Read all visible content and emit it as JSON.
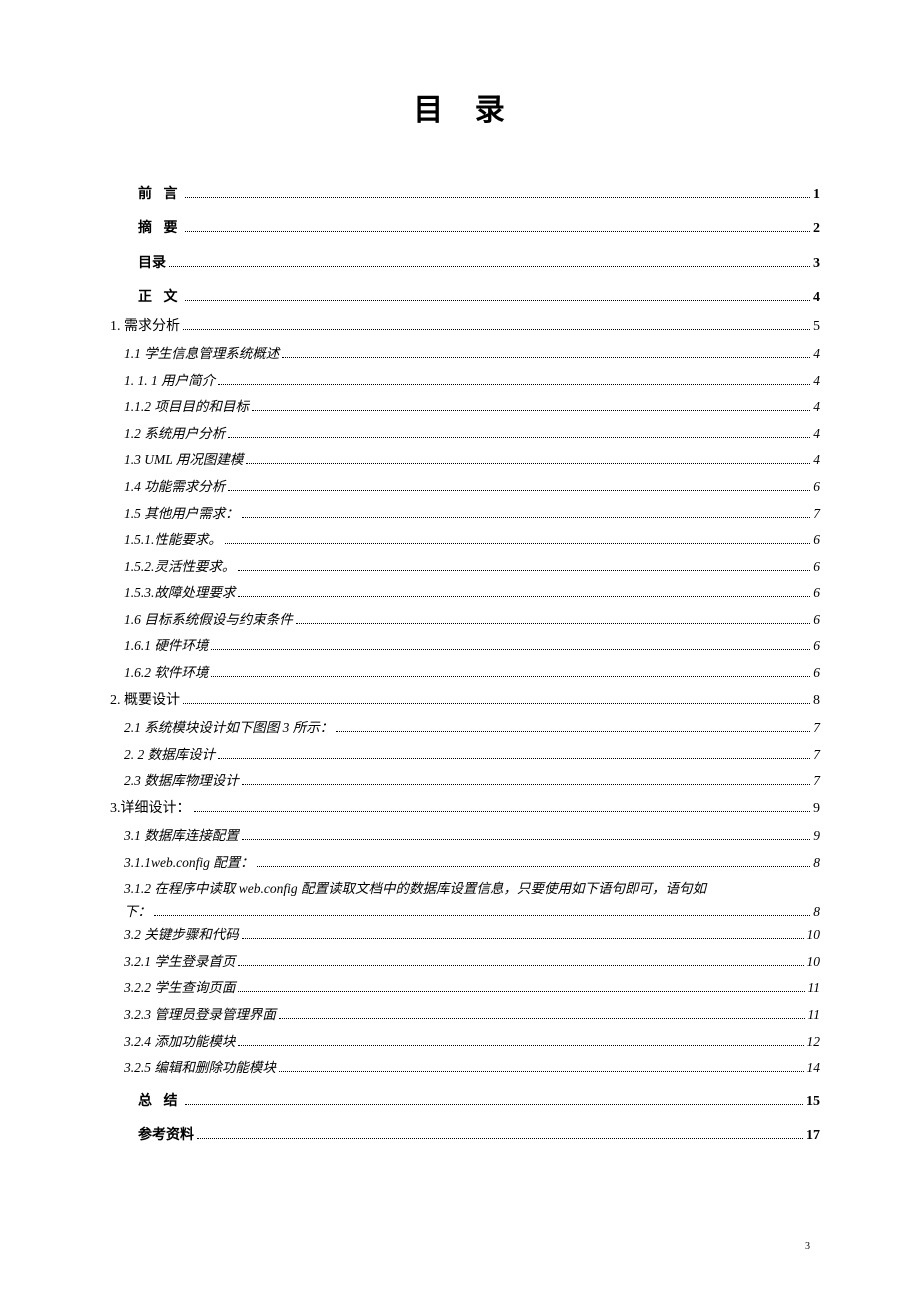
{
  "title": "目 录",
  "footer_page": "3",
  "entries": [
    {
      "type": "top",
      "label": "前 言",
      "page": "1",
      "spaced": true
    },
    {
      "type": "top",
      "label": "摘 要",
      "page": "2",
      "spaced": true
    },
    {
      "type": "top",
      "label": "目录",
      "page": "3"
    },
    {
      "type": "top",
      "label": "正 文",
      "page": "4",
      "spaced": true
    },
    {
      "type": "chapter",
      "label": "1. 需求分析",
      "page": "5"
    },
    {
      "type": "sub",
      "label": "1.1  学生信息管理系统概述",
      "page": "4"
    },
    {
      "type": "sub",
      "label": "1. 1. 1   用户简介",
      "page": "4"
    },
    {
      "type": "sub",
      "label": "1.1.2   项目目的和目标",
      "page": "4"
    },
    {
      "type": "sub",
      "label": "1.2  系统用户分析",
      "page": "4"
    },
    {
      "type": "sub",
      "label": "1.3 UML 用况图建模",
      "page": "4"
    },
    {
      "type": "sub",
      "label": "1.4  功能需求分析",
      "page": "6"
    },
    {
      "type": "sub",
      "label": "1.5  其他用户需求：",
      "page": "7"
    },
    {
      "type": "sub",
      "label": "1.5.1.性能要求。",
      "page": "6"
    },
    {
      "type": "sub",
      "label": "1.5.2.灵活性要求。",
      "page": "6"
    },
    {
      "type": "sub",
      "label": "1.5.3.故障处理要求",
      "page": "6"
    },
    {
      "type": "sub",
      "label": "1.6  目标系统假设与约束条件",
      "page": "6"
    },
    {
      "type": "sub",
      "label": "1.6.1   硬件环境",
      "page": "6"
    },
    {
      "type": "sub",
      "label": "1.6.2   软件环境",
      "page": "6"
    },
    {
      "type": "chapter",
      "label": "2. 概要设计",
      "page": "8"
    },
    {
      "type": "sub",
      "label": "2.1  系统模块设计如下图图 3 所示：",
      "page": "7"
    },
    {
      "type": "sub",
      "label": "2. 2  数据库设计",
      "page": "7"
    },
    {
      "type": "sub",
      "label": "2.3  数据库物理设计",
      "page": "7"
    },
    {
      "type": "chapter",
      "label": "3.详细设计：",
      "page": "9"
    },
    {
      "type": "sub",
      "label": "3.1 数据库连接配置",
      "page": "9"
    },
    {
      "type": "sub",
      "label": "3.1.1web.config 配置：",
      "page": "8"
    },
    {
      "type": "wrap",
      "label_line1": "3.1.2 在程序中读取 web.config 配置读取文档中的数据库设置信息，只要使用如下语句即可，语句如",
      "label_line2": "下：",
      "page": "8"
    },
    {
      "type": "sub",
      "label": "3.2  关键步骤和代码",
      "page": "10"
    },
    {
      "type": "sub",
      "label": "3.2.1 学生登录首页",
      "page": "10"
    },
    {
      "type": "sub",
      "label": "3.2.2 学生查询页面",
      "page": "11"
    },
    {
      "type": "sub",
      "label": "3.2.3  管理员登录管理界面",
      "page": "11"
    },
    {
      "type": "sub",
      "label": "3.2.4 添加功能模块",
      "page": "12"
    },
    {
      "type": "sub",
      "label": "3.2.5 编辑和删除功能模块",
      "page": "14"
    },
    {
      "type": "top",
      "label": "总 结",
      "page": "15",
      "spaced": true
    },
    {
      "type": "top",
      "label": "参考资料",
      "page": "17"
    }
  ]
}
